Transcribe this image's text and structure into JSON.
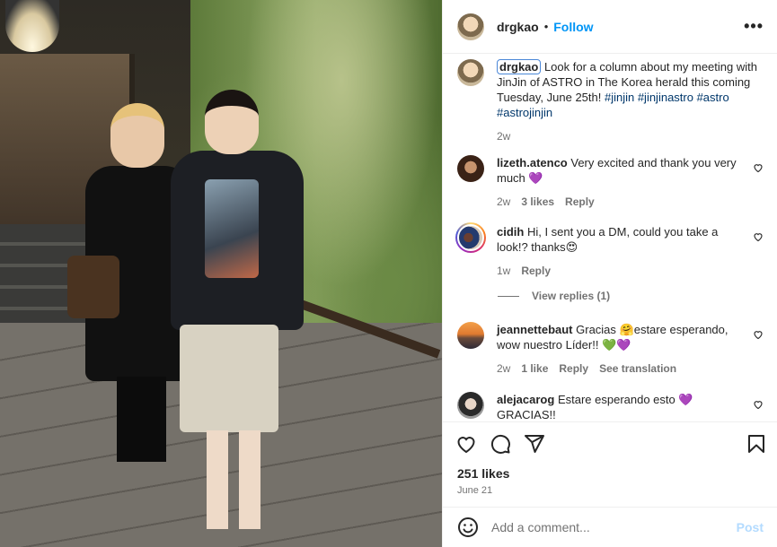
{
  "post": {
    "username": "drgkao",
    "follow_label": "Follow",
    "more_label": "•••",
    "caption": {
      "username": "drgkao",
      "text": " Look for a column about my meeting with JinJin of ASTRO in The Korea herald this coming Tuesday, June 25th! ",
      "hashtags": "#jinjin #jinjinastro #astro #astrojinjin",
      "time": "2w"
    },
    "comments": [
      {
        "username": "lizeth.atenco",
        "text": " Very excited and thank you very much 💜",
        "time": "2w",
        "likes": "3 likes",
        "reply": "Reply"
      },
      {
        "username": "cidih",
        "text": " Hi, I sent you a DM, could you take a look!? thanks😍",
        "time": "1w",
        "reply": "Reply",
        "view_replies": "View replies (1)"
      },
      {
        "username": "jeannettebaut",
        "text": " Gracias 🤗estare esperando, wow nuestro Líder!! 💚💜",
        "time": "2w",
        "likes": "1 like",
        "reply": "Reply",
        "translation": "See translation"
      },
      {
        "username": "alejacarog",
        "text": " Estare esperando esto 💜 GRACIAS!!"
      }
    ],
    "likes": "251 likes",
    "date": "June 21",
    "add_comment": {
      "placeholder": "Add a comment...",
      "post_label": "Post"
    }
  },
  "icons": {
    "like": "heart-icon",
    "comment": "comment-icon",
    "share": "share-icon",
    "save": "bookmark-icon",
    "emoji": "emoji-icon"
  },
  "colors": {
    "link_blue": "#0095f6",
    "hashtag": "#00376b",
    "muted": "#737373",
    "post_disabled": "#b3dbff"
  }
}
